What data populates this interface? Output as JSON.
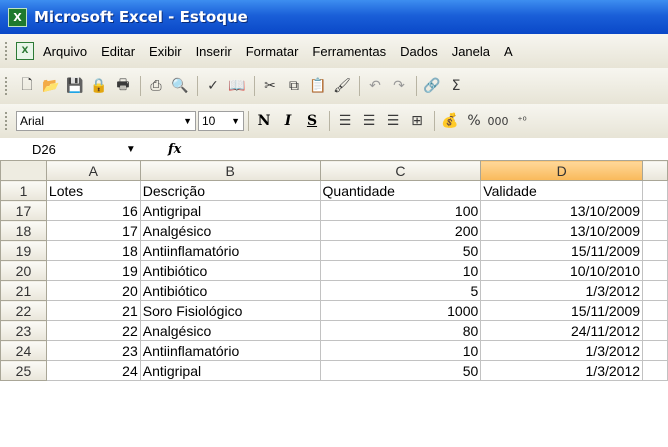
{
  "window": {
    "title": "Microsoft Excel - Estoque",
    "app_icon": "excel-icon"
  },
  "menu": {
    "items": [
      "Arquivo",
      "Editar",
      "Exibir",
      "Inserir",
      "Formatar",
      "Ferramentas",
      "Dados",
      "Janela",
      "A"
    ]
  },
  "format": {
    "font_name": "Arial",
    "font_size": "10",
    "bold": "N",
    "italic": "I",
    "underline": "S",
    "percent": "%",
    "thousands": "000"
  },
  "formula_bar": {
    "cell_ref": "D26",
    "fx": "fx",
    "value": ""
  },
  "sheet": {
    "columns": [
      "A",
      "B",
      "C",
      "D"
    ],
    "active_column": "D",
    "header_row": {
      "num": "1",
      "cells": [
        "Lotes",
        "Descrição",
        "Quantidade",
        "Validade"
      ]
    },
    "rows": [
      {
        "num": "17",
        "cells": [
          "16",
          "Antigripal",
          "100",
          "13/10/2009"
        ]
      },
      {
        "num": "18",
        "cells": [
          "17",
          "Analgésico",
          "200",
          "13/10/2009"
        ]
      },
      {
        "num": "19",
        "cells": [
          "18",
          "Antiinflamatório",
          "50",
          "15/11/2009"
        ]
      },
      {
        "num": "20",
        "cells": [
          "19",
          "Antibiótico",
          "10",
          "10/10/2010"
        ]
      },
      {
        "num": "21",
        "cells": [
          "20",
          "Antibiótico",
          "5",
          "1/3/2012"
        ]
      },
      {
        "num": "22",
        "cells": [
          "21",
          "Soro Fisiológico",
          "1000",
          "15/11/2009"
        ]
      },
      {
        "num": "23",
        "cells": [
          "22",
          "Analgésico",
          "80",
          "24/11/2012"
        ]
      },
      {
        "num": "24",
        "cells": [
          "23",
          "Antiinflamatório",
          "10",
          "1/3/2012"
        ]
      },
      {
        "num": "25",
        "cells": [
          "24",
          "Antigripal",
          "50",
          "1/3/2012"
        ]
      }
    ]
  }
}
